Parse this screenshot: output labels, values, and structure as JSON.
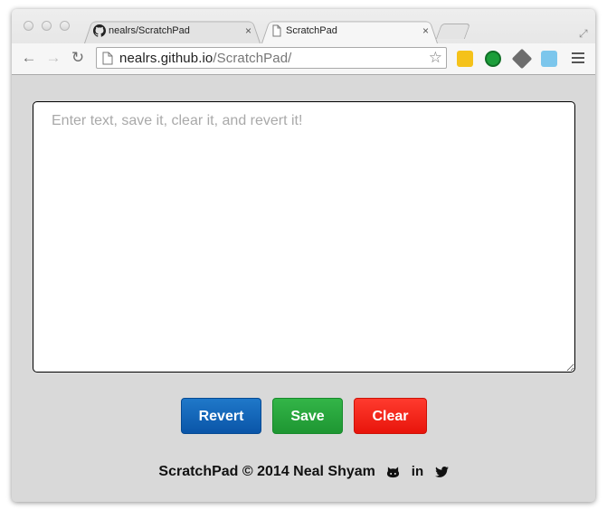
{
  "browser": {
    "tabs": [
      {
        "title": "nealrs/ScratchPad",
        "close": "×"
      },
      {
        "title": "ScratchPad",
        "close": "×"
      }
    ],
    "url_host": "nealrs.github.io",
    "url_path": "/ScratchPad/",
    "nav": {
      "back": "←",
      "forward": "→",
      "reload": "↻"
    },
    "star": "☆"
  },
  "scratchpad": {
    "placeholder": "Enter text, save it, clear it, and revert it!",
    "buttons": {
      "revert": "Revert",
      "save": "Save",
      "clear": "Clear"
    }
  },
  "footer": {
    "text": "ScratchPad © 2014 Neal Shyam",
    "linkedin": "in"
  },
  "colors": {
    "revert": "#0a55a8",
    "save": "#1e9632",
    "clear": "#e8140b",
    "background": "#d9d9d9"
  },
  "icons": [
    "github-icon",
    "linkedin-icon",
    "twitter-icon",
    "page-icon",
    "star-icon",
    "menu-icon"
  ]
}
